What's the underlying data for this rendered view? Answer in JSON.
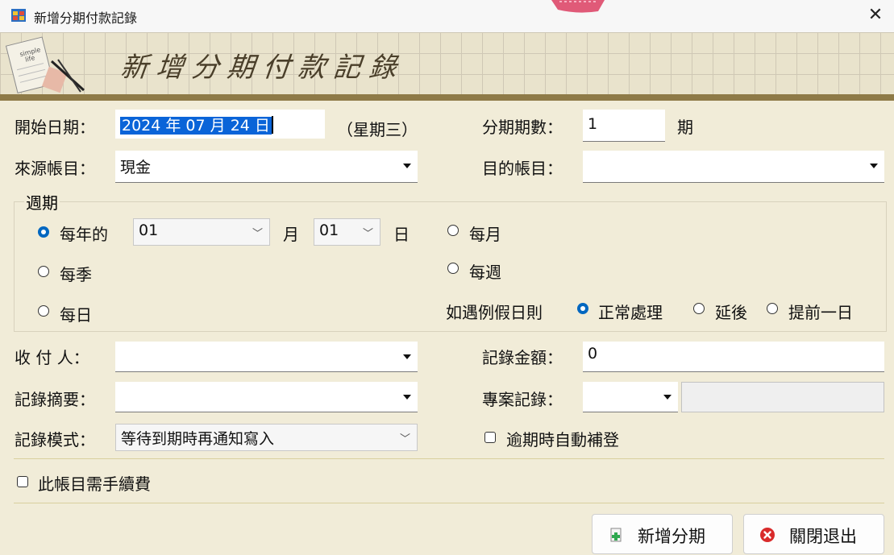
{
  "window": {
    "title": "新增分期付款記錄",
    "close_glyph": "✕"
  },
  "banner": {
    "title": "新增分期付款記錄",
    "art_text_line1": "simple",
    "art_text_line2": "life"
  },
  "start_date": {
    "label": "開始日期：",
    "value": "2024 年 07 月 24 日",
    "weekday": "（星期三）"
  },
  "installments": {
    "label": "分期期數：",
    "value": "1",
    "unit": "期"
  },
  "source_account": {
    "label": "來源帳目：",
    "value": "現金"
  },
  "target_account": {
    "label": "目的帳目：",
    "value": ""
  },
  "period": {
    "title": "週期",
    "yearly": {
      "label": "每年的",
      "month_value": "01",
      "month_unit": "月",
      "day_value": "01",
      "day_unit": "日",
      "selected": true
    },
    "monthly": {
      "label": "每月",
      "selected": false
    },
    "quarterly": {
      "label": "每季",
      "selected": false
    },
    "weekly": {
      "label": "每週",
      "selected": false
    },
    "daily": {
      "label": "每日",
      "selected": false
    },
    "holiday": {
      "label": "如遇例假日則",
      "options": [
        {
          "label": "正常處理",
          "selected": true
        },
        {
          "label": "延後",
          "selected": false
        },
        {
          "label": "提前一日",
          "selected": false
        }
      ]
    }
  },
  "payee": {
    "label": "收 付 人：",
    "value": ""
  },
  "amount": {
    "label": "記錄金額：",
    "value": "0"
  },
  "summary": {
    "label": "記錄摘要：",
    "value": ""
  },
  "project": {
    "label": "專案記錄：",
    "value": "",
    "detail": ""
  },
  "mode": {
    "label": "記錄模式：",
    "value": "等待到期時再通知寫入"
  },
  "auto_fill": {
    "label": "逾期時自動補登",
    "checked": false
  },
  "fee": {
    "label": "此帳目需手續費",
    "checked": false
  },
  "buttons": {
    "add": "新增分期",
    "close": "關閉退出"
  },
  "colors": {
    "selection": "#0a64d8",
    "radio_on": "#0067c0",
    "banner_bar": "#8e7a47",
    "form_bg": "#f1ecd8"
  }
}
